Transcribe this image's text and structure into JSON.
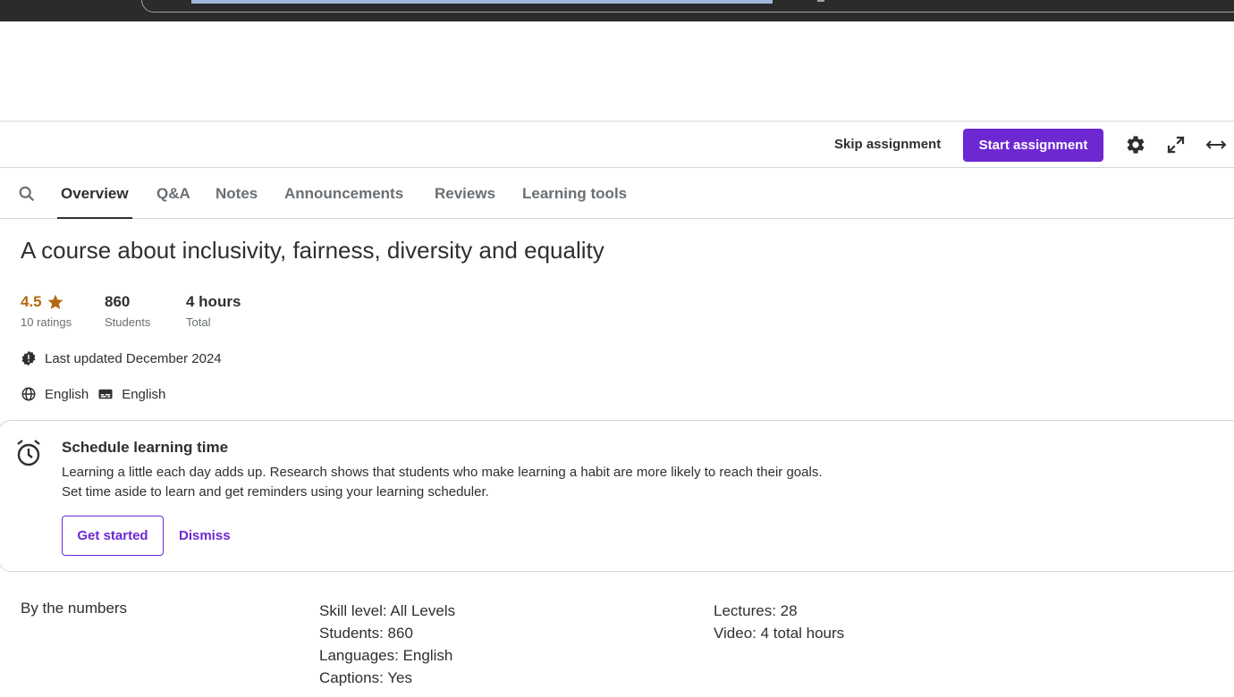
{
  "assignment_bar": {
    "skip_label": "Skip assignment",
    "start_label": "Start assignment",
    "settings_icon": "gear-icon",
    "fullscreen_icon": "expand-icon",
    "widen_icon": "horizontal-arrows-icon"
  },
  "tabs": {
    "search_icon": "search-icon",
    "items": [
      {
        "label": "Overview",
        "active": true
      },
      {
        "label": "Q&A",
        "active": false
      },
      {
        "label": "Notes",
        "active": false
      },
      {
        "label": "Announcements",
        "active": false
      },
      {
        "label": "Reviews",
        "active": false
      },
      {
        "label": "Learning tools",
        "active": false
      }
    ]
  },
  "course": {
    "title": "A course about inclusivity, fairness, diversity and equality",
    "rating": {
      "value": "4.5",
      "label": "10 ratings"
    },
    "students": {
      "value": "860",
      "label": "Students"
    },
    "duration": {
      "value": "4 hours",
      "label": "Total"
    },
    "last_updated": "Last updated December 2024",
    "language": "English",
    "captions": "English"
  },
  "schedule_card": {
    "title": "Schedule learning time",
    "line1": "Learning a little each day adds up. Research shows that students who make learning a habit are more likely to reach their goals.",
    "line2": "Set time aside to learn and get reminders using your learning scheduler.",
    "primary_label": "Get started",
    "secondary_label": "Dismiss"
  },
  "by_the_numbers": {
    "label": "By the numbers",
    "col1": [
      "Skill level: All Levels",
      "Students: 860",
      "Languages: English",
      "Captions: Yes"
    ],
    "col2": [
      "Lectures: 28",
      "Video: 4 total hours"
    ]
  },
  "colors": {
    "accent": "#6d28d2",
    "rating": "#b4690e",
    "text": "#2d2f31",
    "muted": "#6a6f73",
    "border": "#d1d7dc"
  }
}
